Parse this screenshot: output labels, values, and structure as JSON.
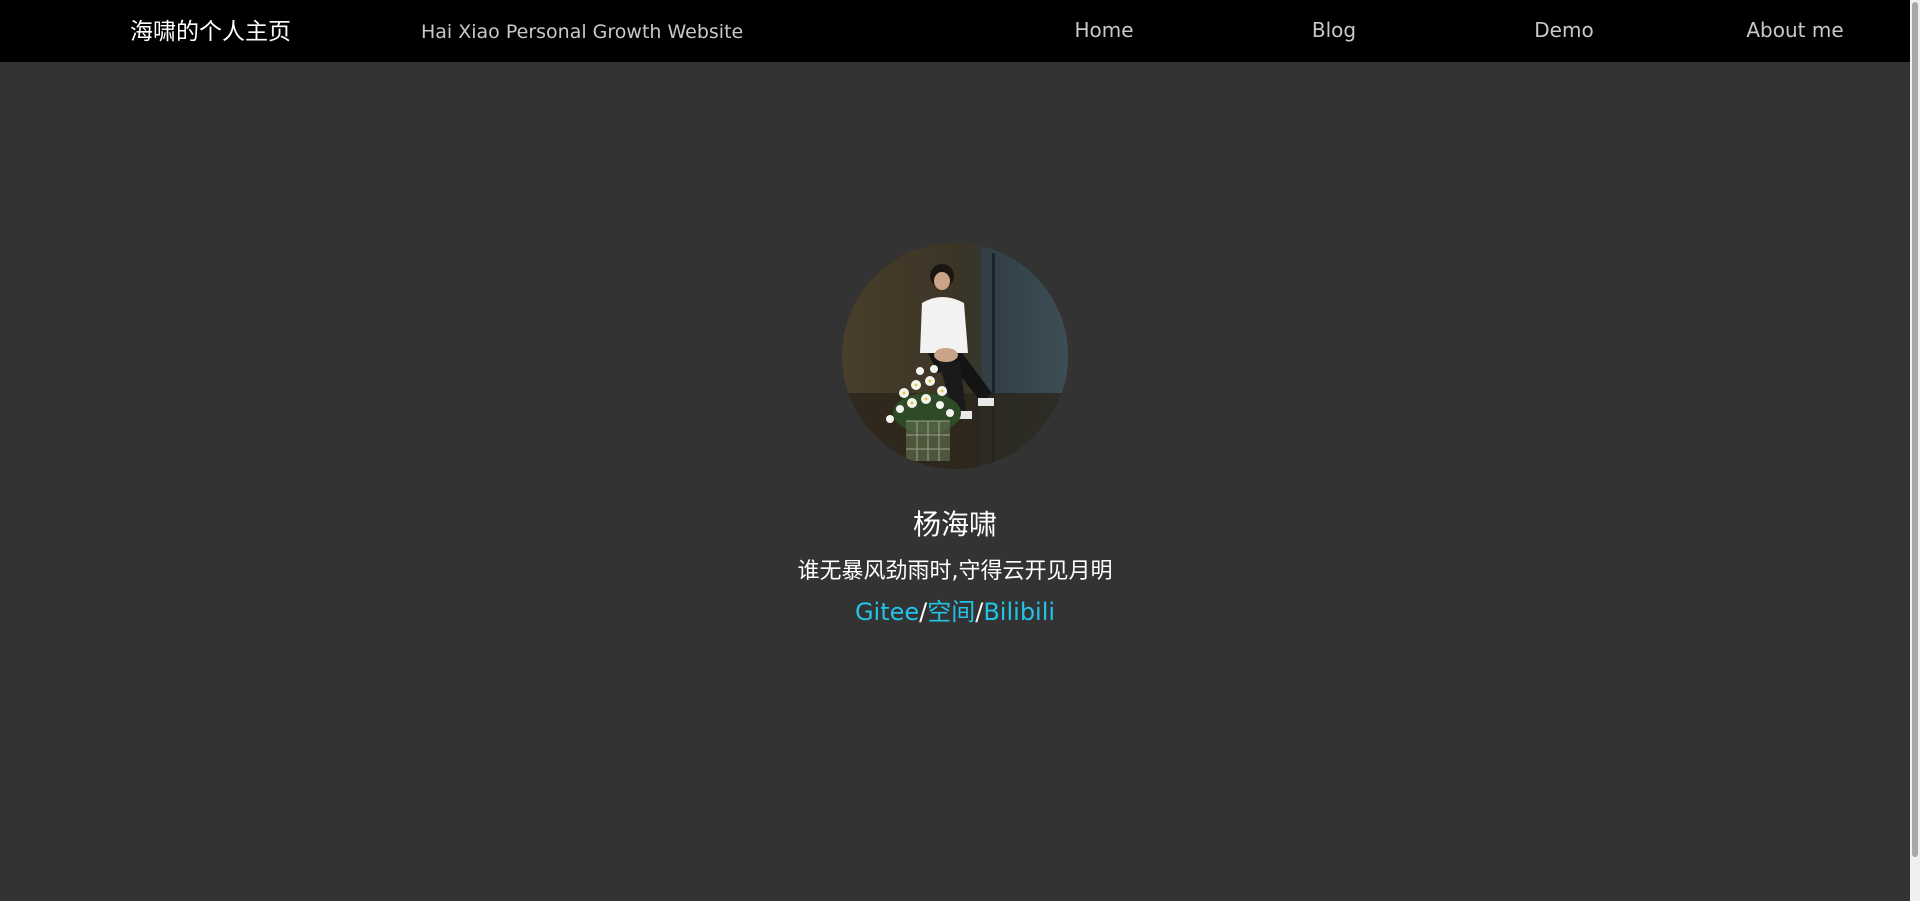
{
  "header": {
    "brand": "海啸的个人主页",
    "tagline": "Hai Xiao Personal Growth Website",
    "nav": {
      "home": "Home",
      "blog": "Blog",
      "demo": "Demo",
      "about": "About me"
    }
  },
  "profile": {
    "name": "杨海啸",
    "motto": "谁无暴风劲雨时,守得云开见月明",
    "links": {
      "gitee": "Gitee",
      "space": "空间",
      "bilibili": "Bilibili",
      "separator": "/"
    }
  },
  "colors": {
    "background": "#333333",
    "navbar": "#000000",
    "link_accent": "#21c4e6"
  }
}
